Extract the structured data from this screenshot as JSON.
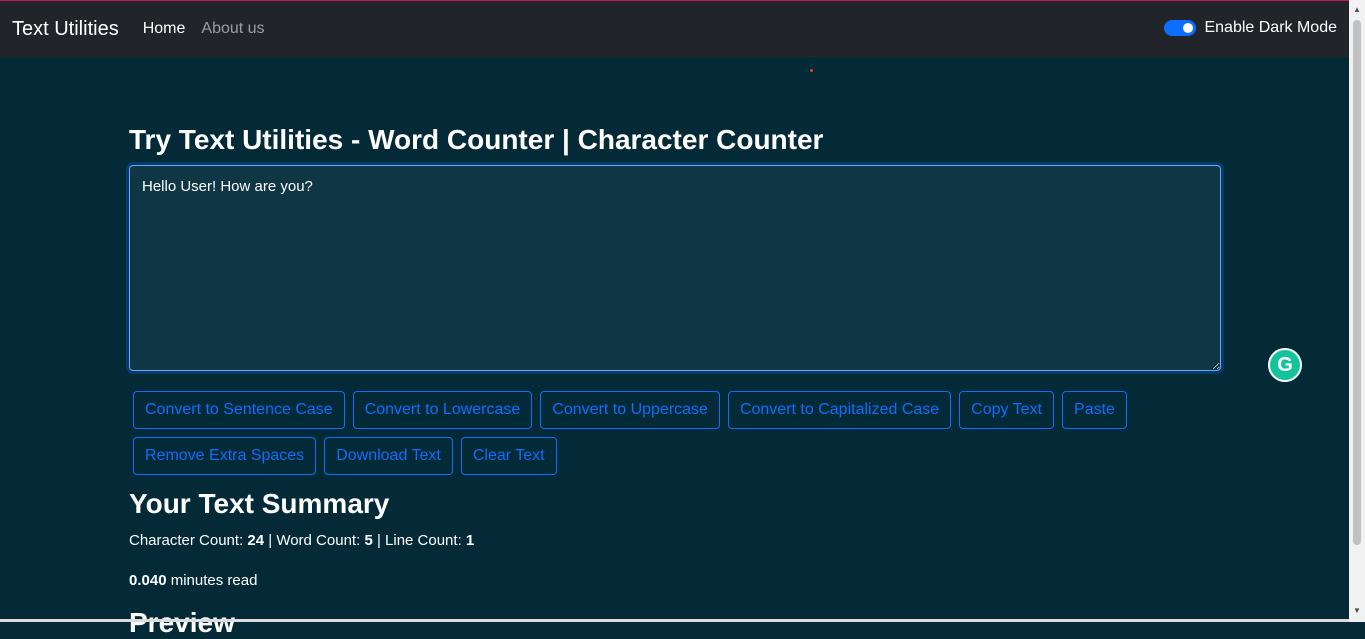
{
  "navbar": {
    "brand": "Text Utilities",
    "links": [
      {
        "label": "Home"
      },
      {
        "label": "About us"
      }
    ],
    "dark_mode_label": "Enable Dark Mode"
  },
  "main": {
    "heading": "Try Text Utilities - Word Counter | Character Counter",
    "textarea_value": "Hello User! How are you?",
    "buttons": [
      "Convert to Sentence Case",
      "Convert to Lowercase",
      "Convert to Uppercase",
      "Convert to Capitalized Case",
      "Copy Text",
      "Paste",
      "Remove Extra Spaces",
      "Download Text",
      "Clear Text"
    ]
  },
  "summary": {
    "heading": "Your Text Summary",
    "char_label": "Character Count:",
    "char_value": "24",
    "word_label": "Word Count:",
    "word_value": "5",
    "line_label": "Line Count:",
    "line_value": "1",
    "read_value": "0.040",
    "read_label": "minutes read",
    "preview_heading": "Preview"
  },
  "colors": {
    "background": "#042a38",
    "navbar": "#212529",
    "accent": "#0d6efd"
  }
}
